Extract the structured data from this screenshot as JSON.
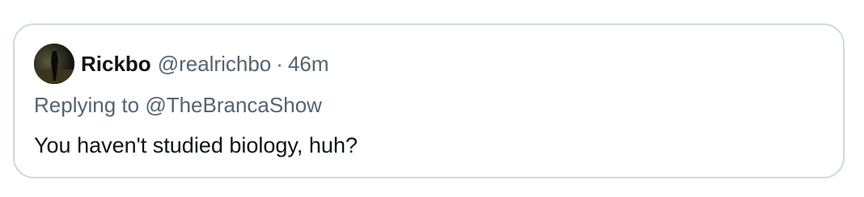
{
  "quoted_tweet": {
    "author": {
      "display_name": "Rickbo",
      "handle": "@realrichbo",
      "avatar": "profile-photo"
    },
    "separator": "·",
    "timestamp": "46m",
    "replying": {
      "prefix": "Replying to",
      "mention": "@TheBrancaShow"
    },
    "text": "You haven't studied biology, huh?"
  },
  "colors": {
    "border": "#cfd9de",
    "primary_text": "#0f1419",
    "secondary_text": "#536471",
    "background": "#ffffff"
  }
}
